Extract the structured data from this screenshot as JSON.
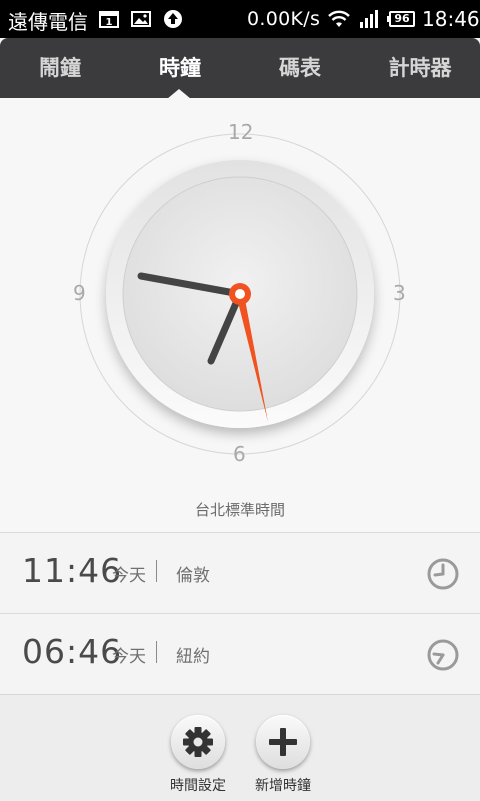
{
  "status_bar": {
    "carrier": "遠傳電信",
    "network_speed": "0.00K/s",
    "battery": "96",
    "time": "18:46",
    "icons": [
      "calendar-icon",
      "gallery-icon",
      "upload-icon",
      "wifi-icon",
      "signal-icon",
      "battery-icon"
    ]
  },
  "tabs": [
    {
      "label": "鬧鐘",
      "active": false
    },
    {
      "label": "時鐘",
      "active": true
    },
    {
      "label": "碼表",
      "active": false
    },
    {
      "label": "計時器",
      "active": false
    }
  ],
  "clock": {
    "dial_labels": {
      "twelve": "12",
      "three": "3",
      "six": "6",
      "nine": "9"
    },
    "time_shown": "18:46",
    "zone_label": "台北標準時間",
    "second_hand_color": "#f0531f"
  },
  "world_clocks": [
    {
      "time": "11:46",
      "day": "今天",
      "city": "倫敦"
    },
    {
      "time": "06:46",
      "day": "今天",
      "city": "紐約"
    }
  ],
  "bottom_actions": [
    {
      "label": "時間設定",
      "icon": "gear-icon"
    },
    {
      "label": "新增時鐘",
      "icon": "plus-icon"
    }
  ],
  "colors": {
    "accent": "#f0531f",
    "tabbar": "#3b3b3d"
  }
}
